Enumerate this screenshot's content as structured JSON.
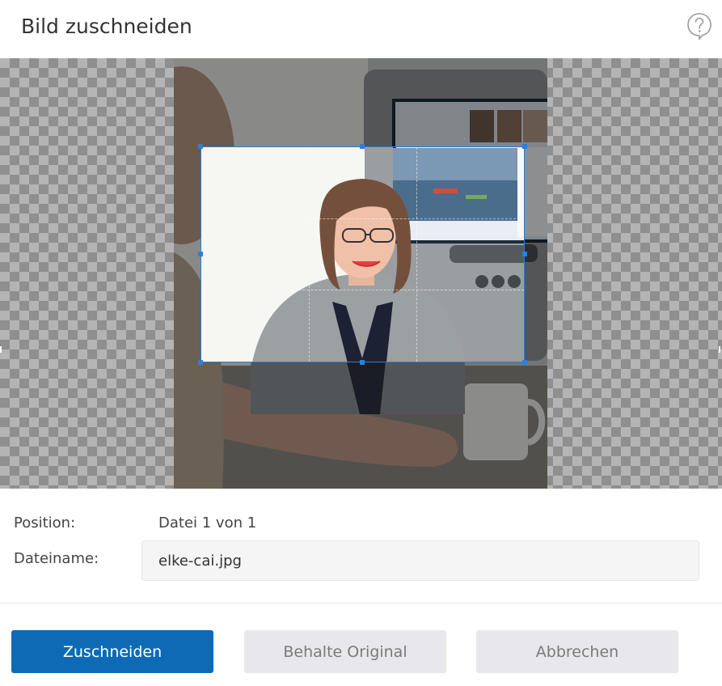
{
  "dialog": {
    "title": "Bild zuschneiden",
    "help_icon": "help-circle-icon"
  },
  "crop": {
    "image_alt": "elke-cai.jpg"
  },
  "form": {
    "position_label": "Position:",
    "position_value": "Datei 1 von 1",
    "filename_label": "Dateiname:",
    "filename_value": "elke-cai.jpg"
  },
  "buttons": {
    "crop_label": "Zuschneiden",
    "keep_original_label": "Behalte Original",
    "cancel_label": "Abbrechen"
  },
  "colors": {
    "accent": "#0f6ab6",
    "crop_border": "#2e7fd6",
    "secondary_button": "#e8e8ec"
  }
}
